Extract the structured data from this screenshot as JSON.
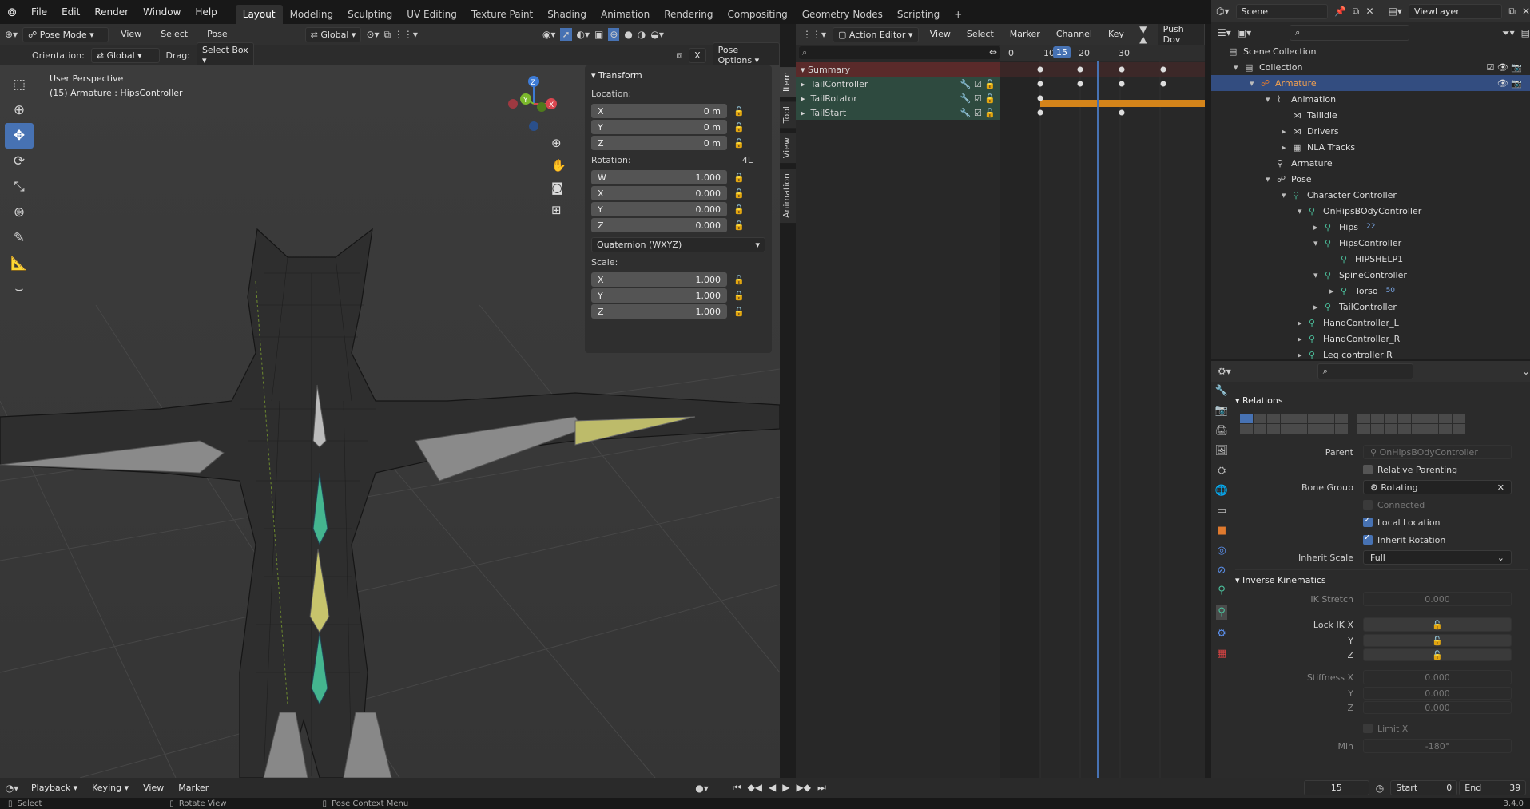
{
  "menubar": {
    "menus": [
      "File",
      "Edit",
      "Render",
      "Window",
      "Help"
    ],
    "workspaces": [
      "Layout",
      "Modeling",
      "Sculpting",
      "UV Editing",
      "Texture Paint",
      "Shading",
      "Animation",
      "Rendering",
      "Compositing",
      "Geometry Nodes",
      "Scripting"
    ],
    "active_workspace": "Layout",
    "add_tab": "+",
    "scene": "Scene",
    "view_layer": "ViewLayer"
  },
  "viewport": {
    "mode": "Pose Mode",
    "menus": [
      "View",
      "Select",
      "Pose"
    ],
    "orientation_label": "Orientation:",
    "orientation_value": "Global",
    "transform_space": "Global",
    "drag_label": "Drag:",
    "drag_value": "Select Box",
    "pose_options": "Pose Options",
    "x_label": "X",
    "perspective": "User Perspective",
    "object_info": "(15) Armature : HipsController",
    "gizmo": {
      "x": "X",
      "y": "Y",
      "z": "Z"
    }
  },
  "npanel": {
    "tabs": [
      "Item",
      "Tool",
      "View",
      "Animation"
    ],
    "section": "Transform",
    "location_label": "Location:",
    "location": [
      {
        "axis": "X",
        "value": "0 m"
      },
      {
        "axis": "Y",
        "value": "0 m"
      },
      {
        "axis": "Z",
        "value": "0 m"
      }
    ],
    "rotation_label": "Rotation:",
    "rotation_mode_short": "4L",
    "rotation": [
      {
        "axis": "W",
        "value": "1.000"
      },
      {
        "axis": "X",
        "value": "0.000"
      },
      {
        "axis": "Y",
        "value": "0.000"
      },
      {
        "axis": "Z",
        "value": "0.000"
      }
    ],
    "rotation_mode": "Quaternion (WXYZ)",
    "scale_label": "Scale:",
    "scale": [
      {
        "axis": "X",
        "value": "1.000"
      },
      {
        "axis": "Y",
        "value": "1.000"
      },
      {
        "axis": "Z",
        "value": "1.000"
      }
    ]
  },
  "action_editor": {
    "editor": "Action Editor",
    "menus": [
      "View",
      "Select",
      "Marker",
      "Channel",
      "Key"
    ],
    "push_down": "Push Dov",
    "frames": [
      "0",
      "10",
      "15",
      "20",
      "30"
    ],
    "current_frame": "15",
    "channels": [
      "Summary",
      "TailController",
      "TailRotator",
      "TailStart"
    ]
  },
  "outliner": {
    "rows": [
      {
        "label": "Scene Collection",
        "indent": 0,
        "icon": "collection-icon",
        "exp": ""
      },
      {
        "label": "Collection",
        "indent": 1,
        "icon": "collection-icon",
        "exp": "▾"
      },
      {
        "label": "Armature",
        "indent": 2,
        "icon": "armature-icon",
        "exp": "▾",
        "selected": true
      },
      {
        "label": "Animation",
        "indent": 3,
        "icon": "animation-icon",
        "exp": "▾"
      },
      {
        "label": "TailIdle",
        "indent": 4,
        "icon": "action-icon",
        "exp": ""
      },
      {
        "label": "Drivers",
        "indent": 4,
        "icon": "drivers-icon",
        "exp": "▸"
      },
      {
        "label": "NLA Tracks",
        "indent": 4,
        "icon": "nla-icon",
        "exp": "▸"
      },
      {
        "label": "Armature",
        "indent": 3,
        "icon": "armature-data-icon",
        "exp": ""
      },
      {
        "label": "Pose",
        "indent": 3,
        "icon": "pose-icon",
        "exp": "▾"
      },
      {
        "label": "Character Controller",
        "indent": 4,
        "icon": "bone-icon",
        "exp": "▾"
      },
      {
        "label": "OnHipsBOdyController",
        "indent": 5,
        "icon": "bone-icon",
        "exp": "▾"
      },
      {
        "label": "Hips",
        "indent": 6,
        "icon": "bone-icon",
        "exp": "▸",
        "extra": "22"
      },
      {
        "label": "HipsController",
        "indent": 6,
        "icon": "bone-icon",
        "exp": "▾"
      },
      {
        "label": "HIPSHELP1",
        "indent": 7,
        "icon": "bone-icon",
        "exp": ""
      },
      {
        "label": "SpineController",
        "indent": 6,
        "icon": "bone-icon",
        "exp": "▾"
      },
      {
        "label": "Torso",
        "indent": 7,
        "icon": "bone-icon",
        "exp": "▸",
        "extra": "50"
      },
      {
        "label": "TailController",
        "indent": 6,
        "icon": "bone-icon",
        "exp": "▸"
      },
      {
        "label": "HandController_L",
        "indent": 5,
        "icon": "bone-icon",
        "exp": "▸"
      },
      {
        "label": "HandController_R",
        "indent": 5,
        "icon": "bone-icon",
        "exp": "▸"
      },
      {
        "label": "Leg controller R",
        "indent": 5,
        "icon": "bone-icon",
        "exp": "▸"
      }
    ]
  },
  "properties": {
    "relations_title": "Relations",
    "parent_label": "Parent",
    "parent_value": "OnHipsBOdyController",
    "relative_parenting": "Relative Parenting",
    "bone_group_label": "Bone Group",
    "bone_group_value": "Rotating",
    "connected": "Connected",
    "local_location": "Local Location",
    "inherit_rotation": "Inherit Rotation",
    "inherit_scale_label": "Inherit Scale",
    "inherit_scale_value": "Full",
    "ik_title": "Inverse Kinematics",
    "ik_stretch_label": "IK Stretch",
    "ik_stretch_value": "0.000",
    "lock_ik_label": "Lock IK X",
    "y_label": "Y",
    "z_label": "Z",
    "stiffness_label": "Stiffness X",
    "stiffness_x": "0.000",
    "stiffness_y": "0.000",
    "stiffness_z": "0.000",
    "limit_x": "Limit X",
    "min_label": "Min",
    "min_value": "-180°"
  },
  "timeline": {
    "menus": [
      "Playback",
      "Keying",
      "View",
      "Marker"
    ],
    "current_frame": "15",
    "start_label": "Start",
    "start_value": "0",
    "end_label": "End",
    "end_value": "39"
  },
  "statusbar": {
    "items": [
      "Select",
      "Rotate View",
      "Pose Context Menu"
    ],
    "version": "3.4.0"
  },
  "colors": {
    "accent": "#4772b3",
    "bone_green": "#4bbf9b",
    "summary_red": "#5a2a2a",
    "orange_bar": "#d4841a"
  }
}
